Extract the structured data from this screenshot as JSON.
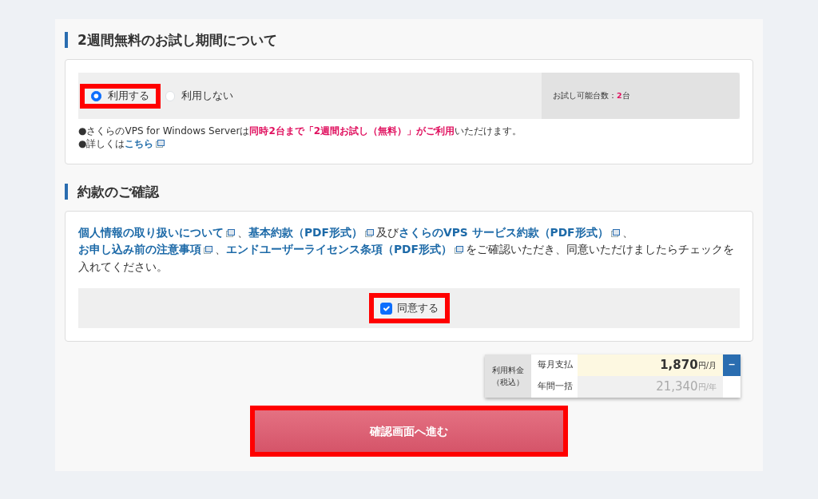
{
  "trial": {
    "heading": "2週間無料のお試し期間について",
    "options": [
      {
        "label": "利用する",
        "selected": true,
        "highlighted": true
      },
      {
        "label": "利用しない",
        "selected": false,
        "highlighted": false
      }
    ],
    "available": {
      "label": "お試し可能台数：",
      "count": "2",
      "unit": "台"
    },
    "notes": [
      [
        {
          "kind": "text",
          "text": "●さくらのVPS for Windows Serverは"
        },
        {
          "kind": "emph",
          "text": "同時2台まで「2週間お試し（無料）」がご利用"
        },
        {
          "kind": "text",
          "text": "いただけます。"
        }
      ],
      [
        {
          "kind": "text",
          "text": "●詳しくは"
        },
        {
          "kind": "link",
          "text": "こちら"
        }
      ]
    ]
  },
  "terms": {
    "heading": "約款のご確認",
    "segments": [
      {
        "kind": "link",
        "text": "個人情報の取り扱いについて"
      },
      {
        "kind": "text",
        "text": "、"
      },
      {
        "kind": "link",
        "text": "基本約款（PDF形式）"
      },
      {
        "kind": "text",
        "text": "及び"
      },
      {
        "kind": "link",
        "text": "さくらのVPS サービス約款（PDF形式）"
      },
      {
        "kind": "text",
        "text": "、"
      },
      {
        "kind": "link",
        "text": "お申し込み前の注意事項"
      },
      {
        "kind": "text",
        "text": "、"
      },
      {
        "kind": "link",
        "text": "エンドユーザーライセンス条項（PDF形式）"
      },
      {
        "kind": "text",
        "text": "をご確認いただき、同意いただけましたらチェックを入れてください。"
      }
    ],
    "agree": {
      "label": "同意する",
      "checked": true,
      "highlighted": true
    }
  },
  "price": {
    "label": "利用料金",
    "sublabel": "（税込）",
    "collapse": "−",
    "rows": [
      {
        "label": "毎月支払",
        "amount": "1,870",
        "unit": "円/月",
        "selected": true
      },
      {
        "label": "年間一括",
        "amount": "21,340",
        "unit": "円/年",
        "selected": false
      }
    ]
  },
  "submit": {
    "label": "確認画面へ進む",
    "highlighted": true
  }
}
